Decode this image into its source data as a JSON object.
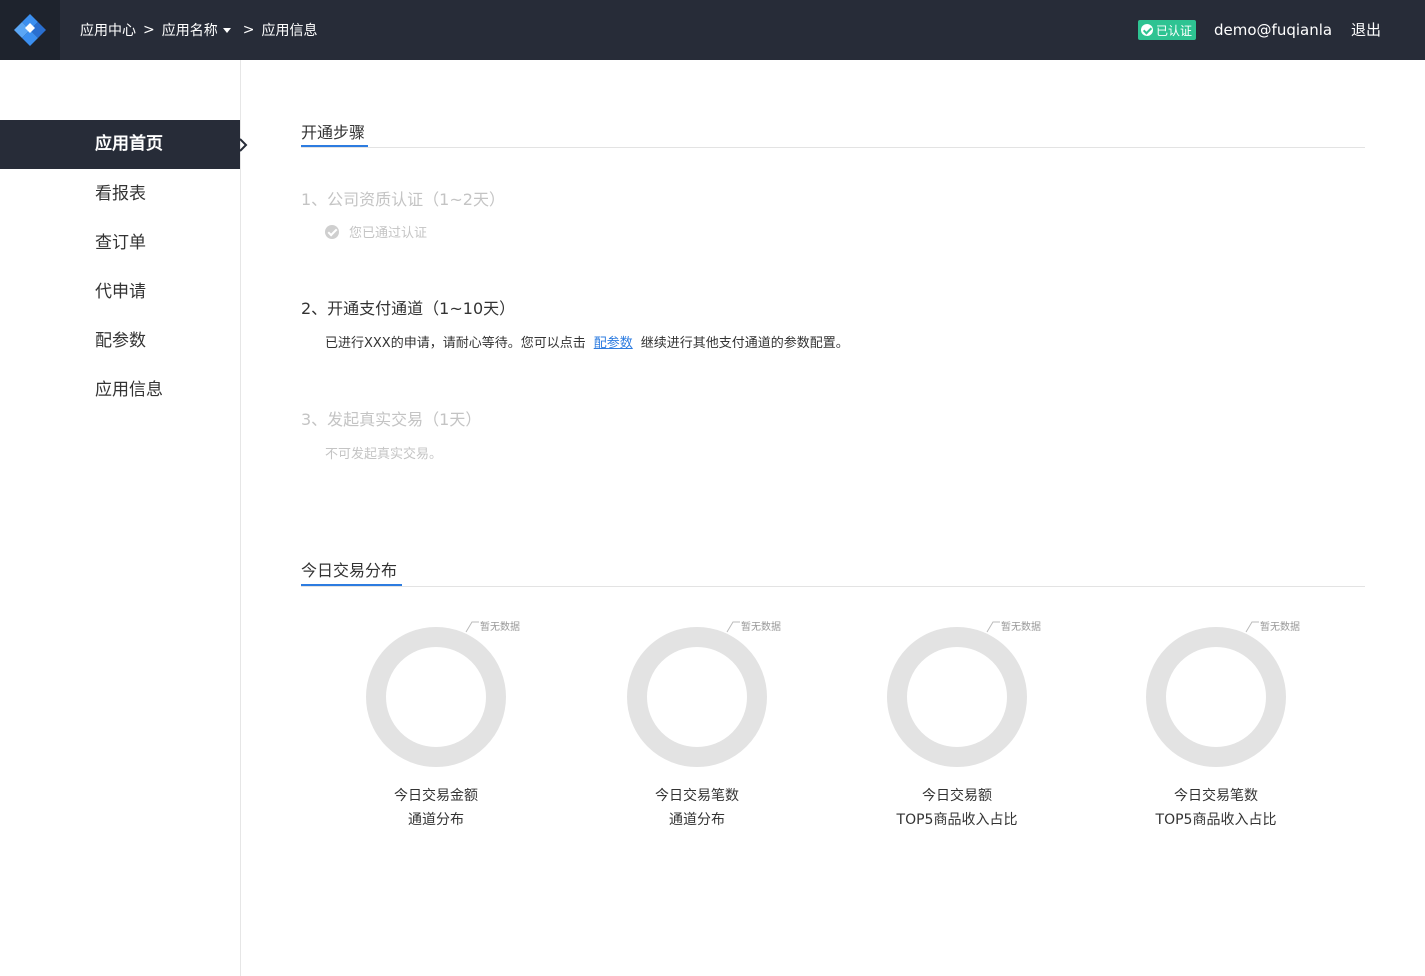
{
  "header": {
    "breadcrumb": {
      "home": "应用中心",
      "separator": ">",
      "app_name": "应用名称",
      "current": "应用信息"
    },
    "verified_badge": "已认证",
    "user_email": "demo@fuqianla",
    "logout_label": "退出"
  },
  "sidebar": {
    "items": [
      {
        "label": "应用首页",
        "active": true
      },
      {
        "label": "看报表",
        "active": false
      },
      {
        "label": "查订单",
        "active": false
      },
      {
        "label": "代申请",
        "active": false
      },
      {
        "label": "配参数",
        "active": false
      },
      {
        "label": "应用信息",
        "active": false
      }
    ]
  },
  "steps_section": {
    "title": "开通步骤",
    "steps": [
      {
        "title": "1、公司资质认证（1~2天）",
        "desc": "您已通过认证",
        "state": "done"
      },
      {
        "title": "2、开通支付通道（1~10天）",
        "desc_before": "已进行XXX的申请，请耐心等待。您可以点击",
        "link": "配参数",
        "desc_after": "继续进行其他支付通道的参数配置。",
        "state": "current"
      },
      {
        "title": "3、发起真实交易（1天）",
        "desc": "不可发起真实交易。",
        "state": "pending"
      }
    ]
  },
  "distribution_section": {
    "title": "今日交易分布",
    "no_data_label": "暂无数据",
    "charts": [
      {
        "line1": "今日交易金额",
        "line2": "通道分布"
      },
      {
        "line1": "今日交易笔数",
        "line2": "通道分布"
      },
      {
        "line1": "今日交易额",
        "line2": "TOP5商品收入占比"
      },
      {
        "line1": "今日交易笔数",
        "line2": "TOP5商品收入占比"
      }
    ]
  },
  "colors": {
    "topbar": "#272c38",
    "accent": "#2d7ce0",
    "verified": "#2ec392",
    "donut_empty": "#e3e3e3"
  }
}
